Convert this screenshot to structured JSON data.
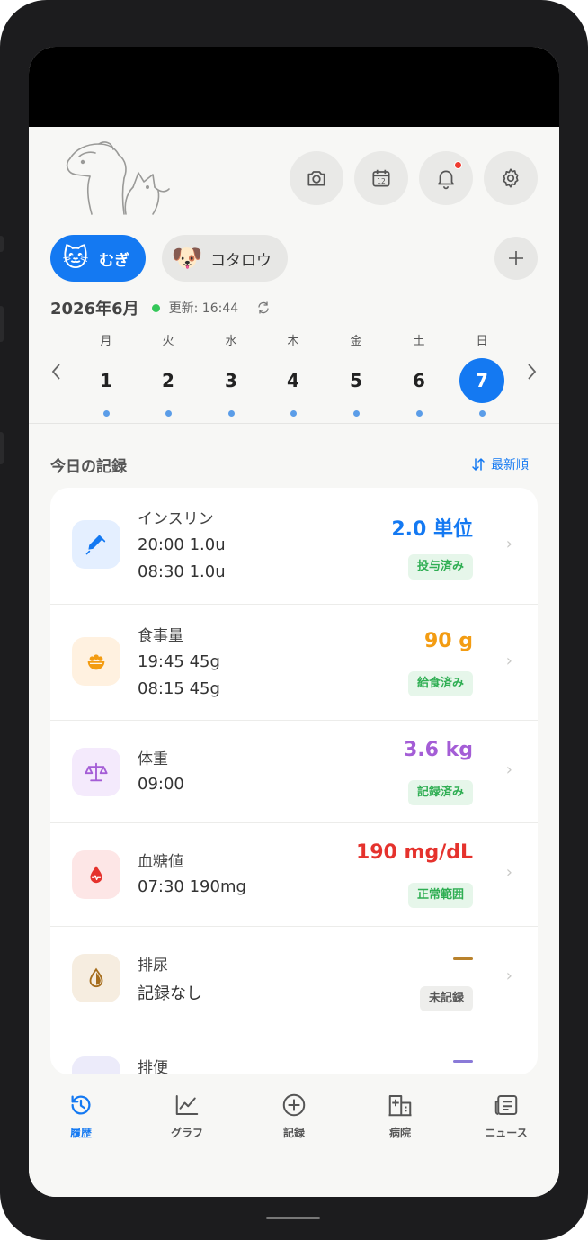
{
  "header": {
    "icons": [
      "camera-icon",
      "calendar-icon",
      "bell-icon",
      "gear-icon"
    ],
    "calendar_day": "12"
  },
  "pets": [
    {
      "name": "むぎ",
      "emoji": "🐱",
      "active": true
    },
    {
      "name": "コタロウ",
      "emoji": "🐶",
      "active": false
    }
  ],
  "date_row": {
    "month": "2026年6月",
    "updated": "更新: 16:44"
  },
  "week": {
    "days": [
      {
        "dow": "月",
        "num": "1"
      },
      {
        "dow": "火",
        "num": "2"
      },
      {
        "dow": "水",
        "num": "3"
      },
      {
        "dow": "木",
        "num": "4"
      },
      {
        "dow": "金",
        "num": "5"
      },
      {
        "dow": "土",
        "num": "6"
      },
      {
        "dow": "日",
        "num": "7",
        "selected": true
      }
    ]
  },
  "section": {
    "title": "今日の記録",
    "sort_label": "最新順"
  },
  "records": [
    {
      "title": "インスリン",
      "lines": [
        "20:00 1.0u",
        "08:30 1.0u"
      ],
      "value": "2.0 単位",
      "value_color": "#1479f2",
      "status": "投与済み",
      "icon": "syringe-icon",
      "icon_bg": "#e4efff"
    },
    {
      "title": "食事量",
      "lines": [
        "19:45 45g",
        "08:15 45g"
      ],
      "value": "90 g",
      "value_color": "#f39c12",
      "status": "給食済み",
      "icon": "food-bowl-icon",
      "icon_bg": "#fff1e0"
    },
    {
      "title": "体重",
      "lines": [
        "09:00"
      ],
      "value": "3.6 kg",
      "value_color": "#a45dd6",
      "status": "記録済み",
      "icon": "scale-icon",
      "icon_bg": "#f4eafc"
    },
    {
      "title": "血糖値",
      "lines": [
        "07:30 190mg"
      ],
      "value": "190 mg/dL",
      "value_color": "#e5322d",
      "status": "正常範囲",
      "icon": "blood-drop-icon",
      "icon_bg": "#fde6e6"
    },
    {
      "title": "排尿",
      "lines": [
        "記録なし"
      ],
      "value": "—",
      "value_color": "#b9822c",
      "status": "未記録",
      "icon": "urine-drop-icon",
      "icon_bg": "#f6ede0"
    },
    {
      "title": "排便",
      "lines": [],
      "value": "—",
      "value_color": "#8a7ad8",
      "status": "",
      "icon": "stool-icon",
      "icon_bg": "#ecebfa"
    }
  ],
  "bottom_nav": [
    {
      "label": "履歴",
      "icon": "history-icon",
      "active": true
    },
    {
      "label": "グラフ",
      "icon": "chart-icon",
      "active": false
    },
    {
      "label": "記録",
      "icon": "plus-circle-icon",
      "active": false
    },
    {
      "label": "病院",
      "icon": "hospital-icon",
      "active": false
    },
    {
      "label": "ニュース",
      "icon": "news-icon",
      "active": false
    }
  ]
}
